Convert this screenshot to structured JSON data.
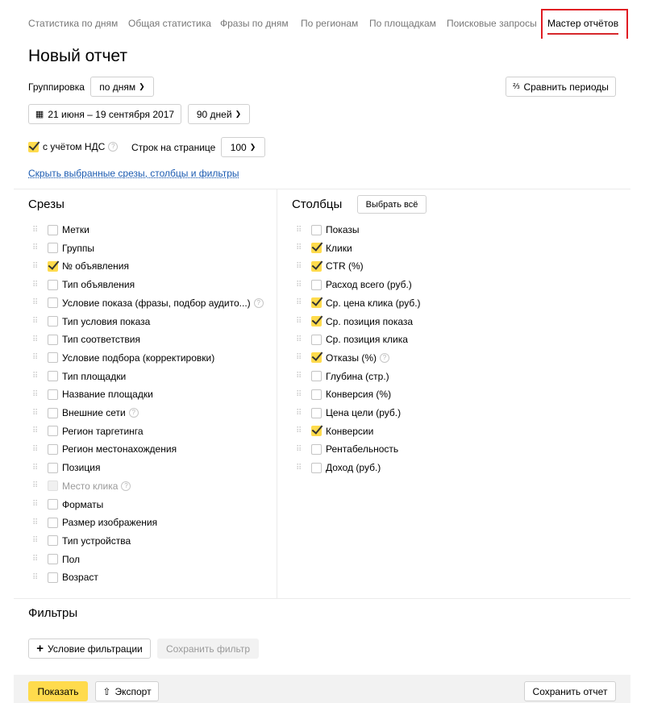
{
  "tabs": [
    {
      "label": "Статистика по дням"
    },
    {
      "label": "Общая статистика"
    },
    {
      "label": "Фразы по дням"
    },
    {
      "label": "По регионам"
    },
    {
      "label": "По площадкам"
    },
    {
      "label": "Поисковые запросы"
    },
    {
      "label": "Мастер отчётов"
    }
  ],
  "active_tab": "Мастер отчётов",
  "page_title": "Новый отчет",
  "grouping": {
    "label": "Группировка",
    "value": "по дням"
  },
  "compare_button": "Сравнить периоды",
  "date_range": "21 июня – 19 сентября 2017",
  "period": "90 дней",
  "vat": {
    "label": "с учётом НДС",
    "checked": true
  },
  "rows_per_page": {
    "label": "Строк на странице",
    "value": "100"
  },
  "hide_link": "Скрыть выбранные срезы, столбцы и фильтры",
  "slices": {
    "title": "Срезы",
    "items": [
      {
        "label": "Метки",
        "checked": false
      },
      {
        "label": "Группы",
        "checked": false
      },
      {
        "label": "№ объявления",
        "checked": true
      },
      {
        "label": "Тип объявления",
        "checked": false
      },
      {
        "label": "Условие показа (фразы, подбор аудито...)",
        "checked": false,
        "help": true
      },
      {
        "label": "Тип условия показа",
        "checked": false
      },
      {
        "label": "Тип соответствия",
        "checked": false
      },
      {
        "label": "Условие подбора (корректировки)",
        "checked": false
      },
      {
        "label": "Тип площадки",
        "checked": false
      },
      {
        "label": "Название площадки",
        "checked": false
      },
      {
        "label": "Внешние сети",
        "checked": false,
        "help": true
      },
      {
        "label": "Регион таргетинга",
        "checked": false
      },
      {
        "label": "Регион местонахождения",
        "checked": false
      },
      {
        "label": "Позиция",
        "checked": false
      },
      {
        "label": "Место клика",
        "checked": false,
        "disabled": true,
        "help": true
      },
      {
        "label": "Форматы",
        "checked": false
      },
      {
        "label": "Размер изображения",
        "checked": false
      },
      {
        "label": "Тип устройства",
        "checked": false
      },
      {
        "label": "Пол",
        "checked": false
      },
      {
        "label": "Возраст",
        "checked": false
      }
    ]
  },
  "columns": {
    "title": "Столбцы",
    "select_all": "Выбрать всё",
    "items": [
      {
        "label": "Показы",
        "checked": false
      },
      {
        "label": "Клики",
        "checked": true
      },
      {
        "label": "CTR (%)",
        "checked": true
      },
      {
        "label": "Расход всего (руб.)",
        "checked": false
      },
      {
        "label": "Ср. цена клика (руб.)",
        "checked": true
      },
      {
        "label": "Ср. позиция показа",
        "checked": true
      },
      {
        "label": "Ср. позиция клика",
        "checked": false
      },
      {
        "label": "Отказы (%)",
        "checked": true,
        "help": true
      },
      {
        "label": "Глубина (стр.)",
        "checked": false
      },
      {
        "label": "Конверсия (%)",
        "checked": false
      },
      {
        "label": "Цена цели (руб.)",
        "checked": false
      },
      {
        "label": "Конверсии",
        "checked": true
      },
      {
        "label": "Рентабельность",
        "checked": false
      },
      {
        "label": "Доход (руб.)",
        "checked": false
      }
    ]
  },
  "filters": {
    "title": "Фильтры",
    "add_condition": "Условие фильтрации",
    "save_filter": "Сохранить фильтр"
  },
  "footer": {
    "show": "Показать",
    "export": "Экспорт",
    "save_report": "Сохранить отчет"
  },
  "colors": {
    "accent_yellow": "#ffdb4d",
    "active_underline": "#d6282c",
    "link": "#1b5bb1",
    "highlight_box": "#e01b22"
  }
}
